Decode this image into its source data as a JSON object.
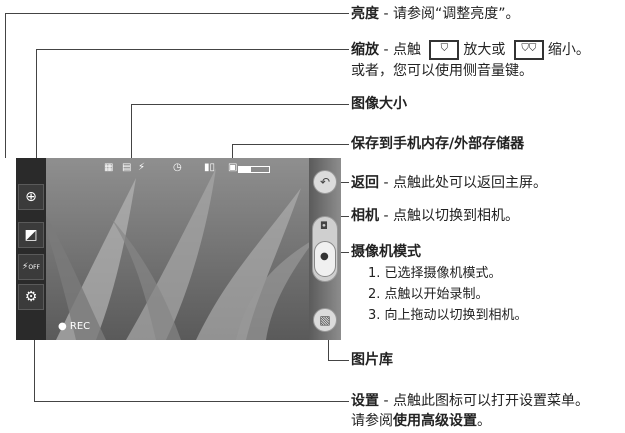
{
  "annotations": {
    "brightness": {
      "title": "亮度",
      "desc": " - 请参阅“调整亮度”。"
    },
    "zoom": {
      "title": "缩放",
      "desc_1": " - 点触",
      "desc_2": "放大或",
      "desc_3": "缩小。",
      "line2": "或者，您可以使用侧音量键。"
    },
    "image_size": {
      "title": "图像大小"
    },
    "storage": {
      "title": "保存到手机内存/外部存储器"
    },
    "back": {
      "title": "返回",
      "desc": " - 点触此处可以返回主屏。"
    },
    "camera": {
      "title": "相机",
      "desc": " - 点触以切换到相机。"
    },
    "video_mode": {
      "title": "摄像机模式",
      "items": [
        "1. 已选择摄像机模式。",
        "2. 点触以开始录制。",
        "3. 向上拖动以切换到相机。"
      ]
    },
    "gallery": {
      "title": "图片库"
    },
    "settings": {
      "title": "设置",
      "desc": " - 点触此图标可以打开设置菜单。",
      "line2_a": "请参阅",
      "line2_b": "使用高级设置",
      "line2_c": "。"
    }
  },
  "screen": {
    "rec_label": "● REC",
    "flash_label": "OFF",
    "icons": [
      "zoom-icon",
      "brightness-icon",
      "flash-off-icon",
      "settings-icon",
      "back-icon",
      "camera-icon",
      "video-mode-icon",
      "gallery-icon"
    ]
  }
}
